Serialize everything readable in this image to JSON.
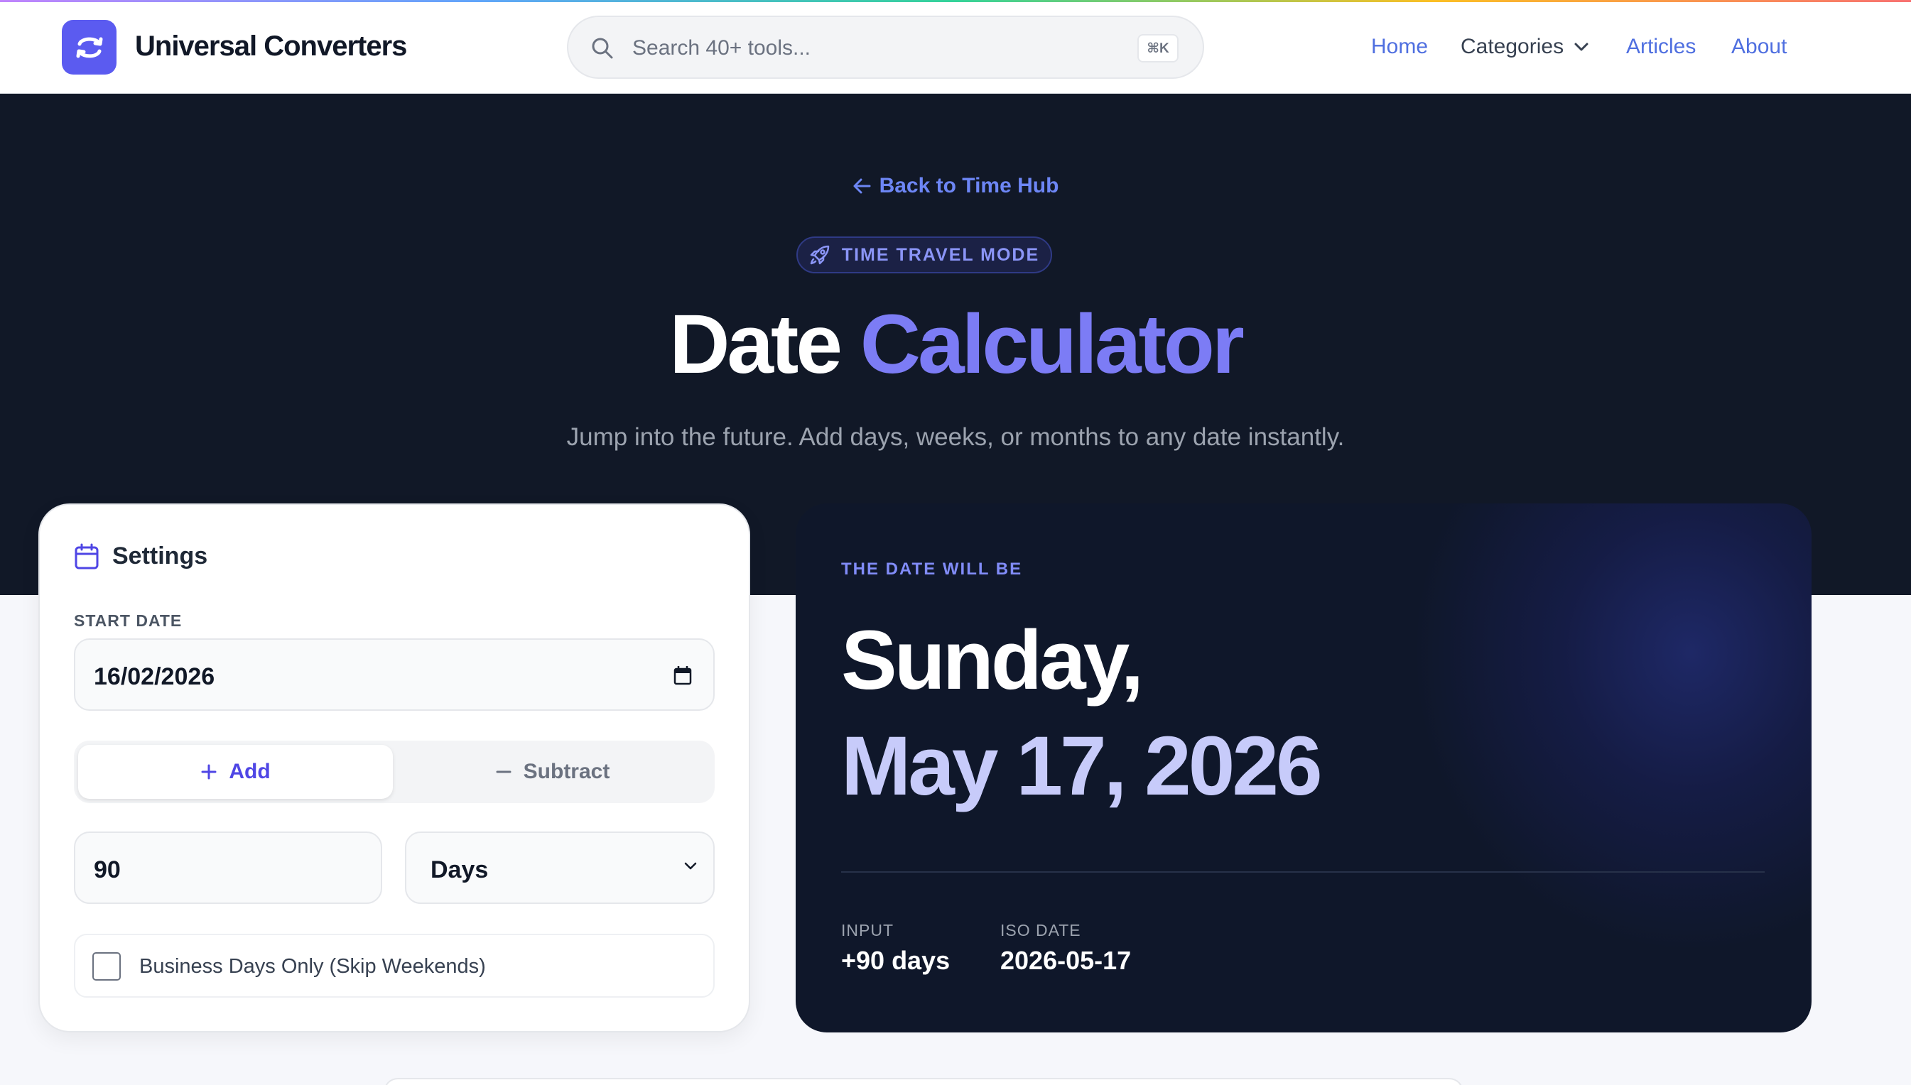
{
  "header": {
    "brand": "Universal Converters",
    "search_placeholder": "Search 40+ tools...",
    "search_shortcut": "⌘K",
    "nav": {
      "home": "Home",
      "categories": "Categories",
      "articles": "Articles",
      "about": "About"
    }
  },
  "hero": {
    "back_link": "Back to Time Hub",
    "badge": "TIME TRAVEL MODE",
    "title_plain": "Date",
    "title_accent": "Calculator",
    "subtitle": "Jump into the future. Add days, weeks, or months to any date instantly."
  },
  "settings": {
    "title": "Settings",
    "start_date_label": "START DATE",
    "start_date_value": "16/02/2026",
    "add_label": "Add",
    "subtract_label": "Subtract",
    "amount_value": "90",
    "unit_value": "Days",
    "business_days_label": "Business Days Only (Skip Weekends)"
  },
  "result": {
    "label": "THE DATE WILL BE",
    "day": "Sunday,",
    "date": "May 17, 2026",
    "input_label": "INPUT",
    "input_value": "+90 days",
    "iso_label": "ISO DATE",
    "iso_value": "2026-05-17"
  },
  "colors": {
    "accent": "#7c7cf5",
    "link": "#4f6fe0",
    "hero_bg": "#111827"
  }
}
